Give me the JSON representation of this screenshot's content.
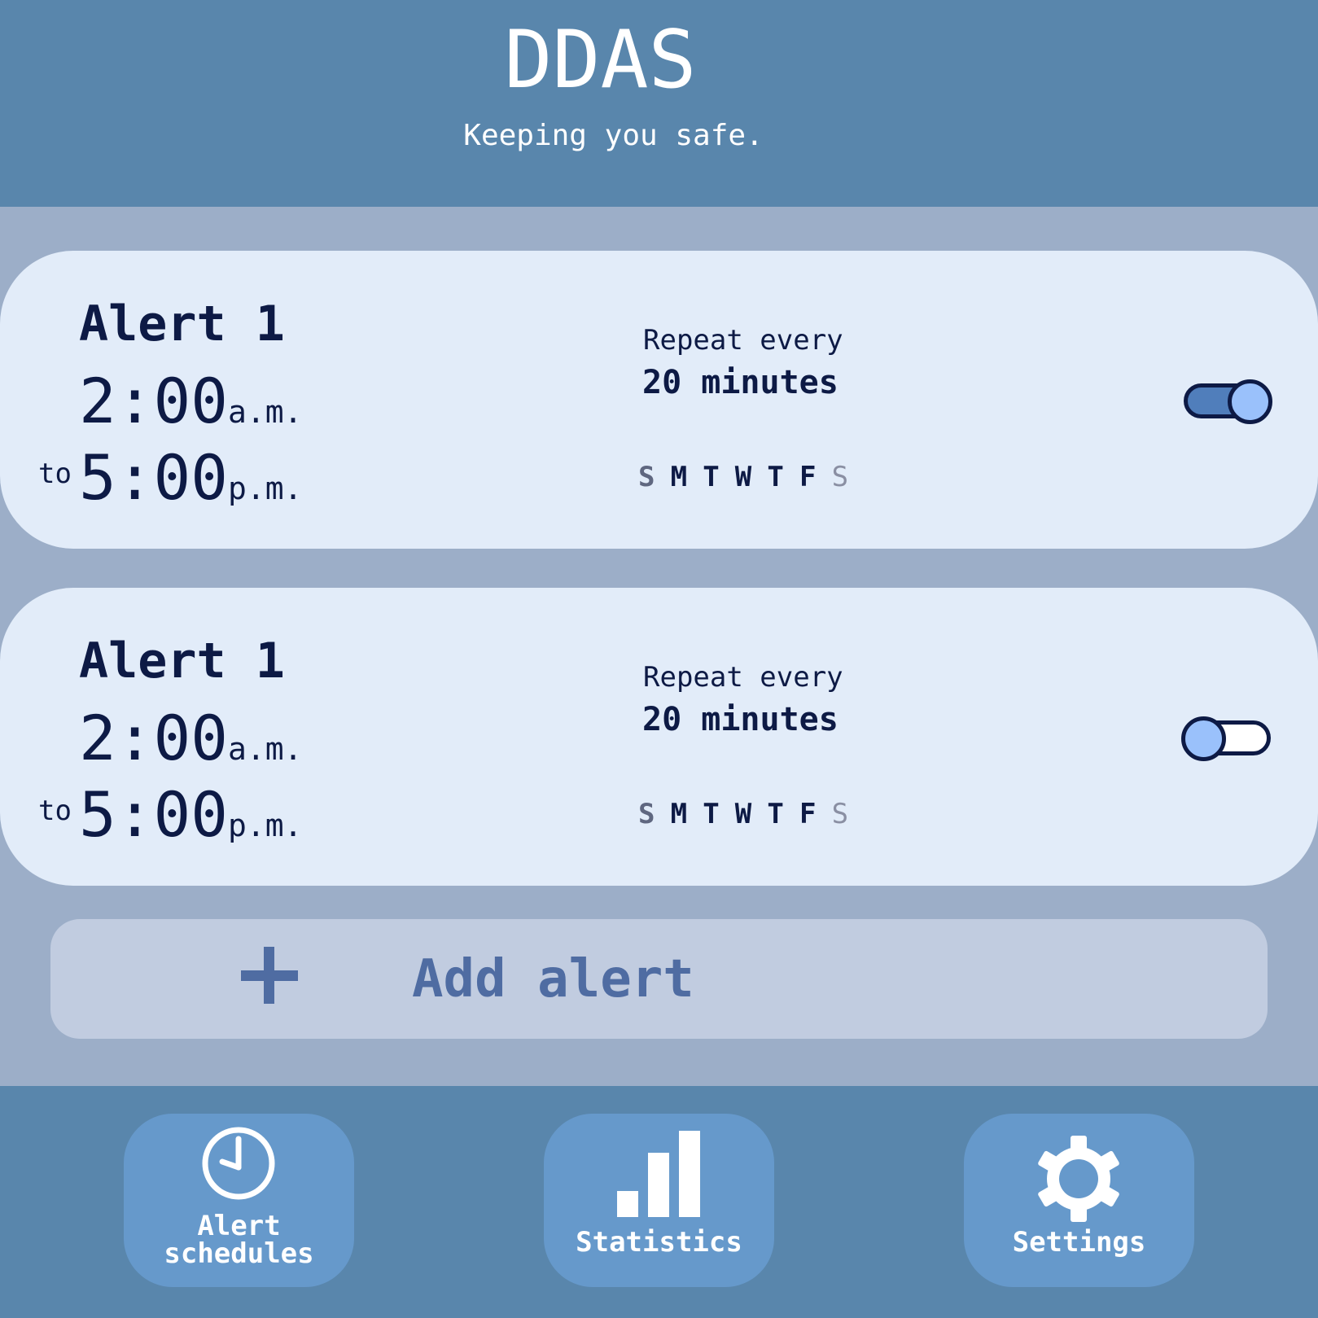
{
  "header": {
    "title": "DDAS",
    "subtitle": "Keeping you safe."
  },
  "alerts": [
    {
      "name": "Alert 1",
      "start_time": "2:00",
      "start_ampm": "a.m.",
      "to_label": "to",
      "end_time": "5:00",
      "end_ampm": "p.m.",
      "repeat_label": "Repeat every",
      "repeat_value": "20 minutes",
      "days": [
        "S",
        "M",
        "T",
        "W",
        "T",
        "F",
        "S"
      ],
      "enabled": true
    },
    {
      "name": "Alert 1",
      "start_time": "2:00",
      "start_ampm": "a.m.",
      "to_label": "to",
      "end_time": "5:00",
      "end_ampm": "p.m.",
      "repeat_label": "Repeat every",
      "repeat_value": "20 minutes",
      "days": [
        "S",
        "M",
        "T",
        "W",
        "T",
        "F",
        "S"
      ],
      "enabled": false
    }
  ],
  "add_alert": {
    "label": "Add alert",
    "icon": "plus-icon"
  },
  "nav": [
    {
      "label_line1": "Alert",
      "label_line2": "schedules",
      "icon": "clock-icon"
    },
    {
      "label": "Statistics",
      "icon": "bar-chart-icon"
    },
    {
      "label": "Settings",
      "icon": "gear-icon"
    }
  ],
  "colors": {
    "header_bg": "#5986ac",
    "page_bg": "#9caec8",
    "card_bg": "#e2ecf9",
    "text_dark": "#0d1a45",
    "accent": "#4f6ca2",
    "toggle_on": "#507ebb",
    "toggle_knob": "#9ac1fb",
    "nav_button": "#6699cb"
  }
}
